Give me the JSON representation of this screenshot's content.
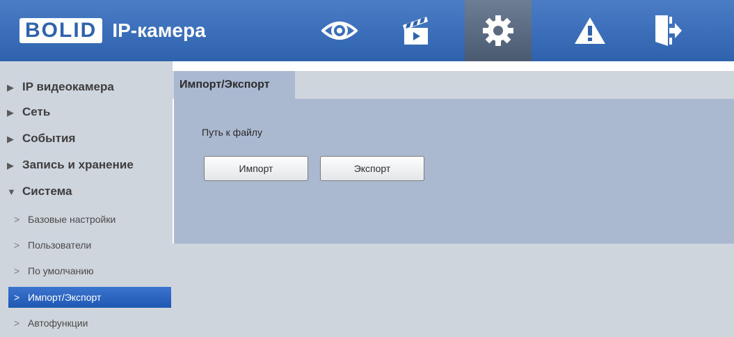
{
  "header": {
    "logo_text": "BOLID",
    "product_title": "IP-камера",
    "nav": [
      {
        "icon": "eye-icon",
        "active": false
      },
      {
        "icon": "clapperboard-icon",
        "active": false
      },
      {
        "icon": "gear-icon",
        "active": true
      },
      {
        "icon": "warning-icon",
        "active": false
      },
      {
        "icon": "logout-icon",
        "active": false
      }
    ]
  },
  "sidebar": {
    "sections": [
      {
        "label": "IP видеокамера",
        "expanded": false
      },
      {
        "label": "Сеть",
        "expanded": false
      },
      {
        "label": "События",
        "expanded": false
      },
      {
        "label": "Запись и хранение",
        "expanded": false
      },
      {
        "label": "Система",
        "expanded": true
      }
    ],
    "items": [
      {
        "label": "Базовые настройки",
        "active": false
      },
      {
        "label": "Пользователи",
        "active": false
      },
      {
        "label": "По умолчанию",
        "active": false
      },
      {
        "label": "Импорт/Экспорт",
        "active": true
      },
      {
        "label": "Автофункции",
        "active": false
      }
    ]
  },
  "main": {
    "tab_label": "Импорт/Экспорт",
    "path_label": "Путь к файлу",
    "import_button": "Импорт",
    "export_button": "Экспорт"
  },
  "colors": {
    "topbar": "#2f62ad",
    "panel": "#aab8d0",
    "sidebar": "#cfd5dd",
    "active_item": "#1f58b2"
  }
}
